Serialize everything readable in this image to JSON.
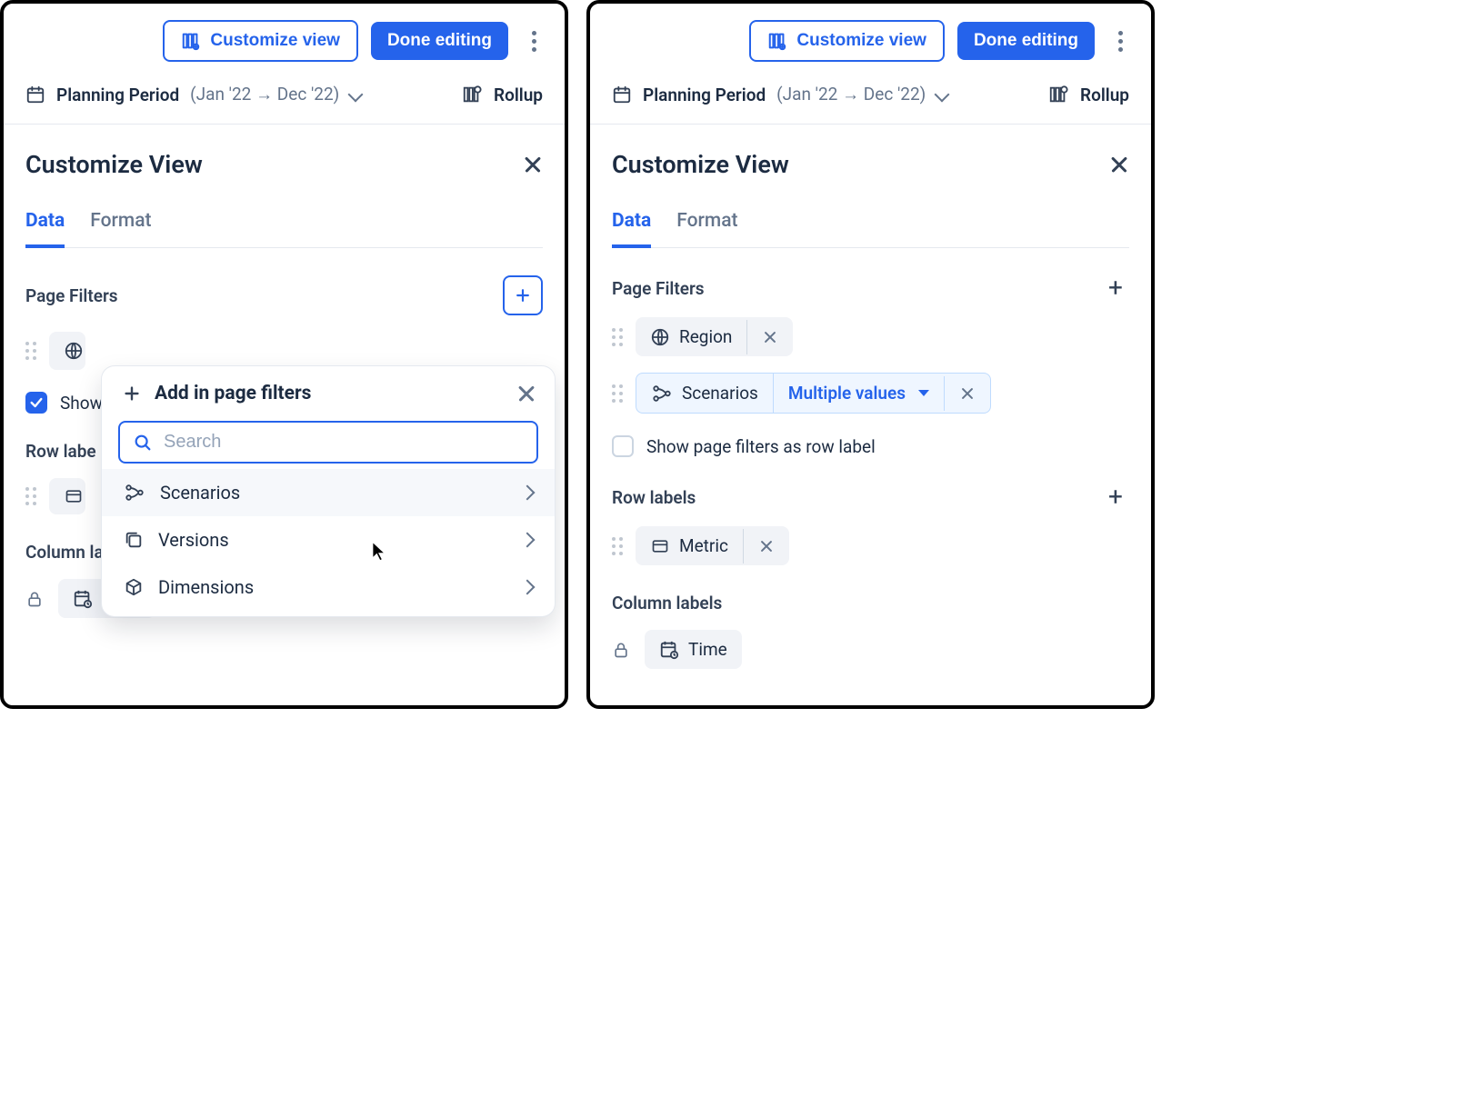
{
  "header": {
    "customize_view_btn": "Customize view",
    "done_editing_btn": "Done editing"
  },
  "subbar": {
    "planning_label": "Planning Period",
    "planning_range": "(Jan '22   →   Dec '22)",
    "rollup_label": "Rollup"
  },
  "panel": {
    "title": "Customize View",
    "tabs": {
      "data": "Data",
      "format": "Format"
    },
    "sections": {
      "page_filters": "Page Filters",
      "row_labels": "Row labels",
      "row_labels_trunc": "Row labe",
      "column_labels": "Column labels",
      "show_filters_label": "Show page filters as row label",
      "show_filters_label_trunc": "Show"
    },
    "chips": {
      "region": "Region",
      "scenarios": "Scenarios",
      "multiple_values": "Multiple values",
      "metric": "Metric",
      "time": "Time"
    }
  },
  "popover": {
    "title": "Add in page filters",
    "search_placeholder": "Search",
    "items": [
      {
        "label": "Scenarios"
      },
      {
        "label": "Versions"
      },
      {
        "label": "Dimensions"
      }
    ]
  }
}
